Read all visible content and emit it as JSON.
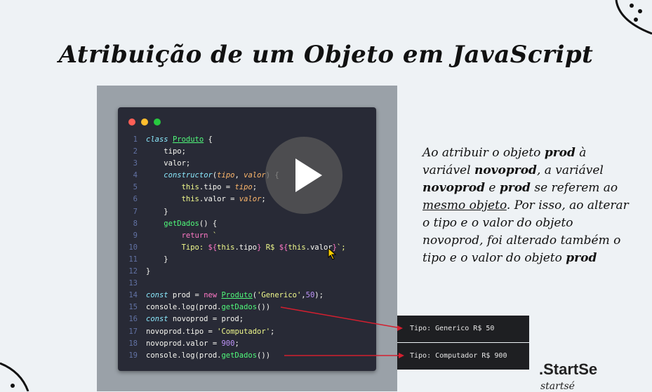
{
  "title": "Atribuição de um Objeto em JavaScript",
  "code_lines": [
    {
      "n": "1"
    },
    {
      "n": "2"
    },
    {
      "n": "3"
    },
    {
      "n": "4"
    },
    {
      "n": "5"
    },
    {
      "n": "6"
    },
    {
      "n": "7"
    },
    {
      "n": "8"
    },
    {
      "n": "9"
    },
    {
      "n": "10"
    },
    {
      "n": "11"
    },
    {
      "n": "12"
    },
    {
      "n": "13"
    },
    {
      "n": "14"
    },
    {
      "n": "15"
    },
    {
      "n": "16"
    },
    {
      "n": "17"
    },
    {
      "n": "18"
    },
    {
      "n": "19"
    }
  ],
  "tokens": {
    "class_kw": "class",
    "class_name": "Produto",
    "brace_open": " {",
    "tipo": "tipo;",
    "valor": "valor;",
    "constructor": "constructor",
    "param_tipo": "tipo",
    "param_valor": "valor",
    "this": "this",
    ".tipo = ": ".tipo = ",
    ".valor = ": ".valor = ",
    "close": "}",
    "getDados": "getDados",
    "return": "return",
    "tmpl_tipo": "Tipo: ",
    "dollar": "$",
    "open_b": "{",
    "close_b": "}",
    "tipo_prop": ".tipo",
    "valor_prop": ".valor",
    "rs": " R$ ",
    "const": "const",
    "prod": " prod = ",
    "new": "new",
    "Produto": "Produto",
    "generico": "'Generico'",
    "fifty": "50",
    "console": "console.log(prod.",
    "getDados2": "getDados",
    "endcall": "())",
    "novoprod": " novoprod = prod;",
    "novo_tipo": "novoprod.tipo = ",
    "computador": "'Computador'",
    "novo_valor": "novoprod.valor = ",
    "nine": "900"
  },
  "outputs": {
    "first": "Tipo: Generico R$ 50",
    "second": "Tipo: Computador R$ 900"
  },
  "explanation": {
    "p1": "Ao atribuir o objeto ",
    "b1": "prod",
    "p2": " à variável ",
    "b2": "novoprod",
    "p3": ", a variável ",
    "b3": "novoprod",
    "p4": " e ",
    "b4": "prod",
    "p5": " se referem ao ",
    "u1": "mesmo objeto",
    "p6": ". Por isso, ao alterar o tipo e o valor do objeto novoprod, foi alterado também o tipo e o valor do objeto ",
    "b5": "prod"
  },
  "brand": {
    "name": ".StartSe",
    "sub": "startsé"
  },
  "icons": {
    "play": "play-icon",
    "cursor": "cursor-icon"
  },
  "colors": {
    "accent_red": "#d31f2f",
    "editor_bg": "#282a36"
  }
}
